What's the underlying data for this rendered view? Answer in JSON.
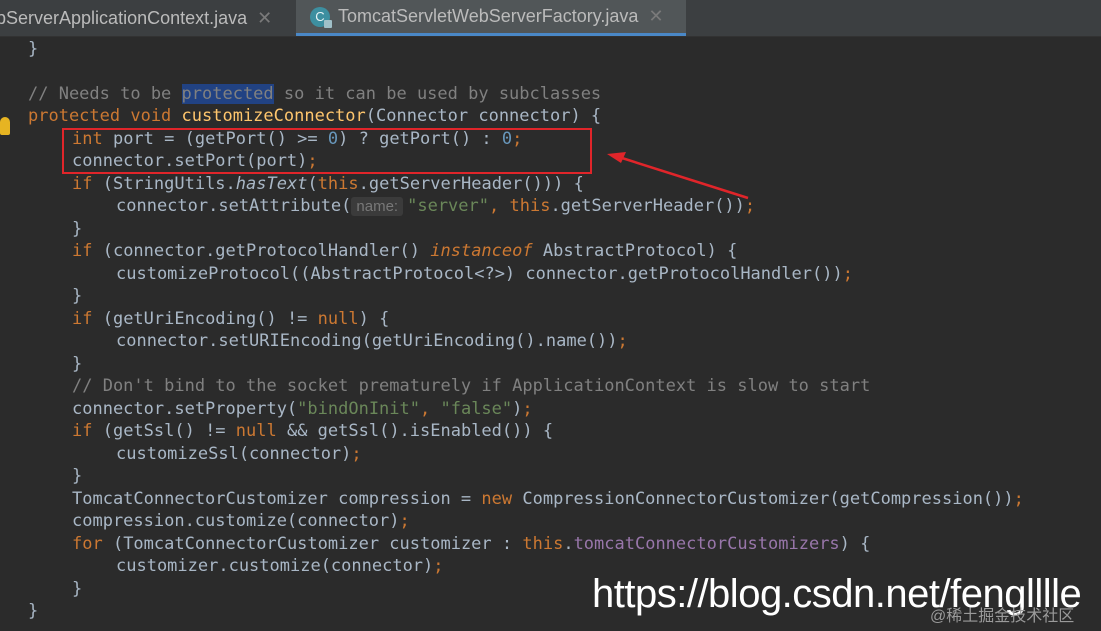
{
  "tabs": [
    {
      "label": "bServerApplicationContext.java",
      "close": "✕"
    },
    {
      "label": "TomcatServletWebServerFactory.java",
      "close": "✕",
      "badge": "C"
    }
  ],
  "code": {
    "l0": "}",
    "l1_comment_a": "// Needs to be ",
    "l1_comment_sel": "protected",
    "l1_comment_b": " so it can be used by subclasses",
    "l2_kw": "protected void ",
    "l2_fn": "customizeConnector",
    "l2_rest": "(Connector connector) {",
    "l3_kw": "int",
    "l3_a": " port = (getPort() >= ",
    "l3_n1": "0",
    "l3_b": ") ? getPort() : ",
    "l3_n2": "0",
    "l3_semi": ";",
    "l4_a": "connector.setPort(port)",
    "l4_semi": ";",
    "l5_kw": "if",
    "l5_a": " (StringUtils.",
    "l5_it": "hasText",
    "l5_b": "(",
    "l5_this": "this",
    "l5_c": ".getServerHeader())) {",
    "l6_a": "connector.setAttribute(",
    "l6_hint": "name:",
    "l6_str": "\"server\"",
    "l6_comma": ", ",
    "l6_this": "this",
    "l6_b": ".getServerHeader())",
    "l6_semi": ";",
    "l7": "}",
    "l8_kw": "if",
    "l8_a": " (connector.getProtocolHandler() ",
    "l8_kw2": "instanceof",
    "l8_b": " AbstractProtocol) {",
    "l9_a": "customizeProtocol((AbstractProtocol<?>) connector.getProtocolHandler())",
    "l9_semi": ";",
    "l10": "}",
    "l11_kw": "if",
    "l11_a": " (getUriEncoding() != ",
    "l11_null": "null",
    "l11_b": ") {",
    "l12_a": "connector.setURIEncoding(getUriEncoding().name())",
    "l12_semi": ";",
    "l13": "}",
    "l14_comment": "// Don't bind to the socket prematurely if ApplicationContext is slow to start",
    "l15_a": "connector.setProperty(",
    "l15_s1": "\"bindOnInit\"",
    "l15_comma": ", ",
    "l15_s2": "\"false\"",
    "l15_b": ")",
    "l15_semi": ";",
    "l16_kw": "if",
    "l16_a": " (getSsl() != ",
    "l16_null": "null",
    "l16_b": " && getSsl().isEnabled()) {",
    "l17_a": "customizeSsl(connector)",
    "l17_semi": ";",
    "l18": "}",
    "l19_a": "TomcatConnectorCustomizer compression = ",
    "l19_new": "new",
    "l19_b": " CompressionConnectorCustomizer(getCompression())",
    "l19_semi": ";",
    "l20_a": "compression.customize(connector)",
    "l20_semi": ";",
    "l21_kw": "for",
    "l21_a": " (TomcatConnectorCustomizer customizer : ",
    "l21_this": "this",
    "l21_dot": ".",
    "l21_fld": "tomcatConnectorCustomizers",
    "l21_b": ") {",
    "l22_a": "customizer.customize(connector)",
    "l22_semi": ";",
    "l23": "}",
    "l24": "}"
  },
  "watermark": "https://blog.csdn.net/fenglllle",
  "watermark2": "@稀土掘金技术社区",
  "colors": {
    "keyword": "#cc7832",
    "function": "#ffc66d",
    "number": "#6897bb",
    "string": "#6a8759",
    "comment": "#808080",
    "field": "#9876aa",
    "annotation_box": "#e0252a"
  }
}
